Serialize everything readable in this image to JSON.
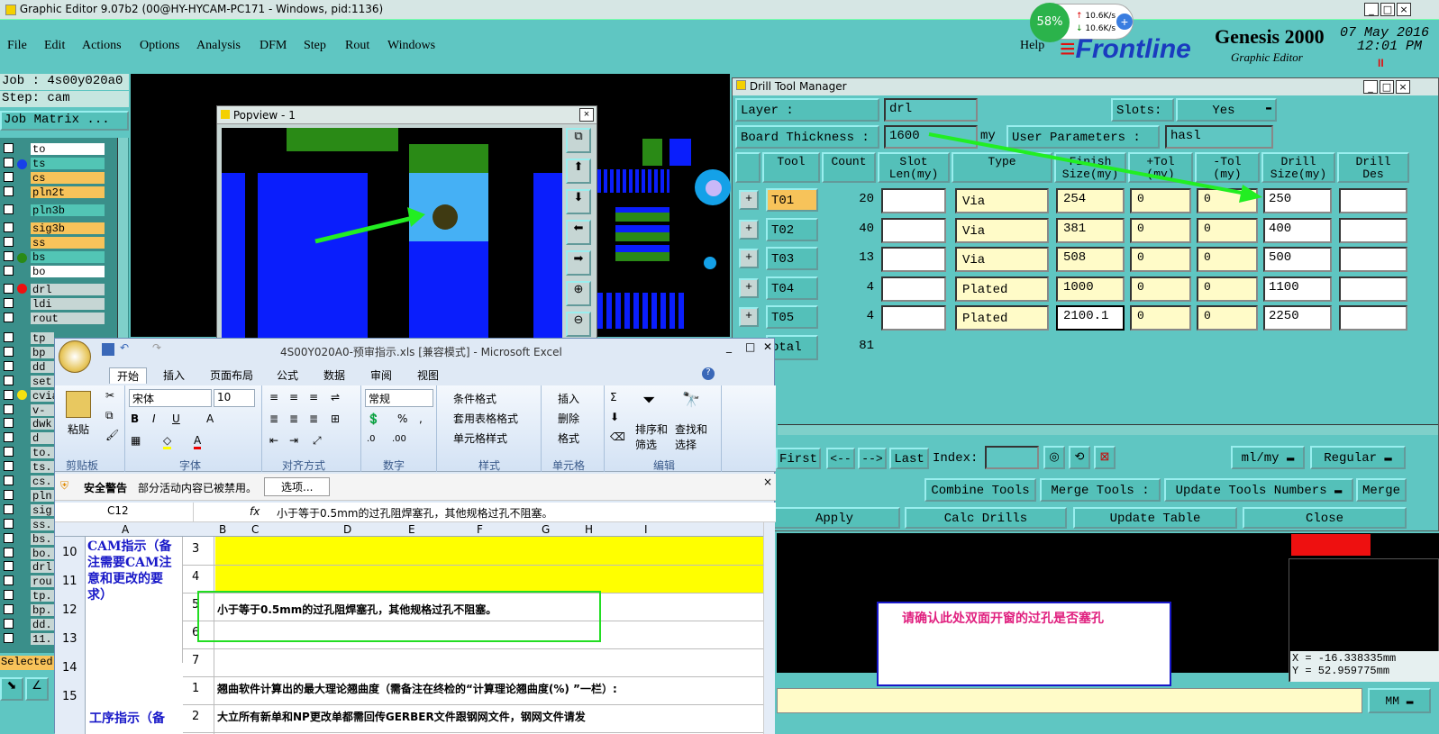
{
  "app_title": "Graphic Editor 9.07b2 (00@HY-HYCAM-PC171 - Windows, pid:1136)",
  "menus": [
    "File",
    "Edit",
    "Actions",
    "Options",
    "Analysis",
    "DFM",
    "Step",
    "Rout",
    "Windows"
  ],
  "help_label": "Help",
  "net": {
    "percent": "58%",
    "up": "10.6K/s",
    "down": "10.6K/s"
  },
  "brand": {
    "logo": "Frontline",
    "product": "Genesis 2000",
    "sub": "Graphic Editor",
    "date": "07 May 2016",
    "time": "12:01 PM"
  },
  "job": "Job : 4s00y020a0",
  "step": "Step: cam",
  "job_matrix": "Job Matrix ...",
  "layers_top": [
    {
      "name": "to",
      "color": "#ffffff"
    },
    {
      "name": "ts",
      "color": "#52c5b5"
    },
    {
      "name": "cs",
      "color": "#f7c35a"
    },
    {
      "name": "pln2t",
      "color": "#f7c35a"
    },
    {
      "name": "pln3b",
      "color": "#52c5b5"
    },
    {
      "name": "sig3b",
      "color": "#f7c35a"
    },
    {
      "name": "ss",
      "color": "#f7c35a"
    },
    {
      "name": "bs",
      "color": "#52c5b5"
    },
    {
      "name": "bo",
      "color": "#ffffff"
    },
    {
      "name": "drl",
      "color": "#c6d6d4"
    },
    {
      "name": "ldi",
      "color": "#c6d6d4"
    },
    {
      "name": "rout",
      "color": "#c6d6d4"
    }
  ],
  "layers_bottom": [
    "tp",
    "bp",
    "dd",
    "set",
    "cvia",
    "v-cv",
    "dwk",
    "d",
    "to.",
    "ts.",
    "cs.",
    "pln",
    "sig",
    "ss.",
    "bs.",
    "bo.",
    "drl",
    "rou",
    "tp.",
    "bp.",
    "dd.",
    "11."
  ],
  "selected_label": "Selected",
  "popview_title": "Popview - 1",
  "drill": {
    "title": "Drill Tool Manager",
    "layer_label": "Layer          :",
    "layer_value": "drl",
    "slots_label": "Slots:",
    "slots_value": "Yes",
    "thickness_label": "Board Thickness :",
    "thickness_value": "1600",
    "thickness_unit": "my",
    "user_params_label": "User Parameters :",
    "user_params_value": "hasl",
    "headers": [
      "Tool",
      "Count",
      "Slot\nLen(my)",
      "Type",
      "Finish\nSize(my)",
      "+Tol\n(my)",
      "-Tol\n(my)",
      "Drill\nSize(my)",
      "Drill\nDes"
    ],
    "rows": [
      {
        "tool": "T01",
        "count": "20",
        "type": "Via",
        "finish": "254",
        "ptol": "0",
        "mtol": "0",
        "drill": "250"
      },
      {
        "tool": "T02",
        "count": "40",
        "type": "Via",
        "finish": "381",
        "ptol": "0",
        "mtol": "0",
        "drill": "400"
      },
      {
        "tool": "T03",
        "count": "13",
        "type": "Via",
        "finish": "508",
        "ptol": "0",
        "mtol": "0",
        "drill": "500"
      },
      {
        "tool": "T04",
        "count": "4",
        "type": "Plated",
        "finish": "1000",
        "ptol": "0",
        "mtol": "0",
        "drill": "1100"
      },
      {
        "tool": "T05",
        "count": "4",
        "type": "Plated",
        "finish": "2100.1",
        "ptol": "0",
        "mtol": "0",
        "drill": "2250"
      }
    ],
    "total_label": "otal",
    "total_value": "81",
    "first": "First",
    "prev": "<--",
    "next": "-->",
    "last": "Last",
    "index": "Index:",
    "unit": "ml/my",
    "mode": "Regular",
    "combine": "Combine Tools",
    "merge_tools": "Merge Tools :",
    "update_numbers": "Update Tools Numbers",
    "merge": "Merge",
    "apply": "Apply",
    "calc": "Calc Drills",
    "update_table": "Update Table",
    "close": "Close"
  },
  "note": "请确认此处双面开窗的过孔是否塞孔",
  "coords": {
    "x": "X = -16.338335mm",
    "y": "Y =  52.959775mm"
  },
  "mm_label": "MM",
  "excel": {
    "title": "4S00Y020A0-预审指示.xls  [兼容模式] - Microsoft Excel",
    "tabs": [
      "开始",
      "插入",
      "页面布局",
      "公式",
      "数据",
      "审阅",
      "视图"
    ],
    "font_name": "宋体",
    "font_size": "10",
    "number_format": "常规",
    "groups": [
      "剪贴板",
      "字体",
      "对齐方式",
      "数字",
      "样式",
      "单元格",
      "编辑"
    ],
    "paste": "粘贴",
    "style_items": [
      "条件格式",
      "套用表格格式",
      "单元格样式"
    ],
    "cell_items": [
      "插入",
      "删除",
      "格式"
    ],
    "edit_items": [
      "排序和\n筛选",
      "查找和\n选择"
    ],
    "security_title": "安全警告",
    "security_msg": "部分活动内容已被禁用。",
    "security_btn": "选项...",
    "cell_ref": "C12",
    "fx": "fx",
    "formula": "小于等于0.5mm的过孔阻焊塞孔，其他规格过孔不阻塞。",
    "col_headers": [
      "A",
      "B",
      "C",
      "D",
      "E",
      "F",
      "G",
      "H",
      "I"
    ],
    "row_nums": [
      "10",
      "11",
      "12",
      "13",
      "14",
      "15"
    ],
    "a_text": "CAM指示（备注需要CAM注意和更改的要求）",
    "b_vals": [
      "3",
      "4",
      "5",
      "6",
      "7",
      "1",
      "2"
    ],
    "c12": "小于等于0.5mm的过孔阻焊塞孔，其他规格过孔不阻塞。",
    "c15": "翘曲软件计算出的最大理论翘曲度（需备注在终检的“计算理论翘曲度(%) ”一栏）:",
    "c16": "大立所有新单和NP更改单都需回传GERBER文件跟钢网文件，钢网文件请发",
    "a15": "工序指示（备"
  }
}
